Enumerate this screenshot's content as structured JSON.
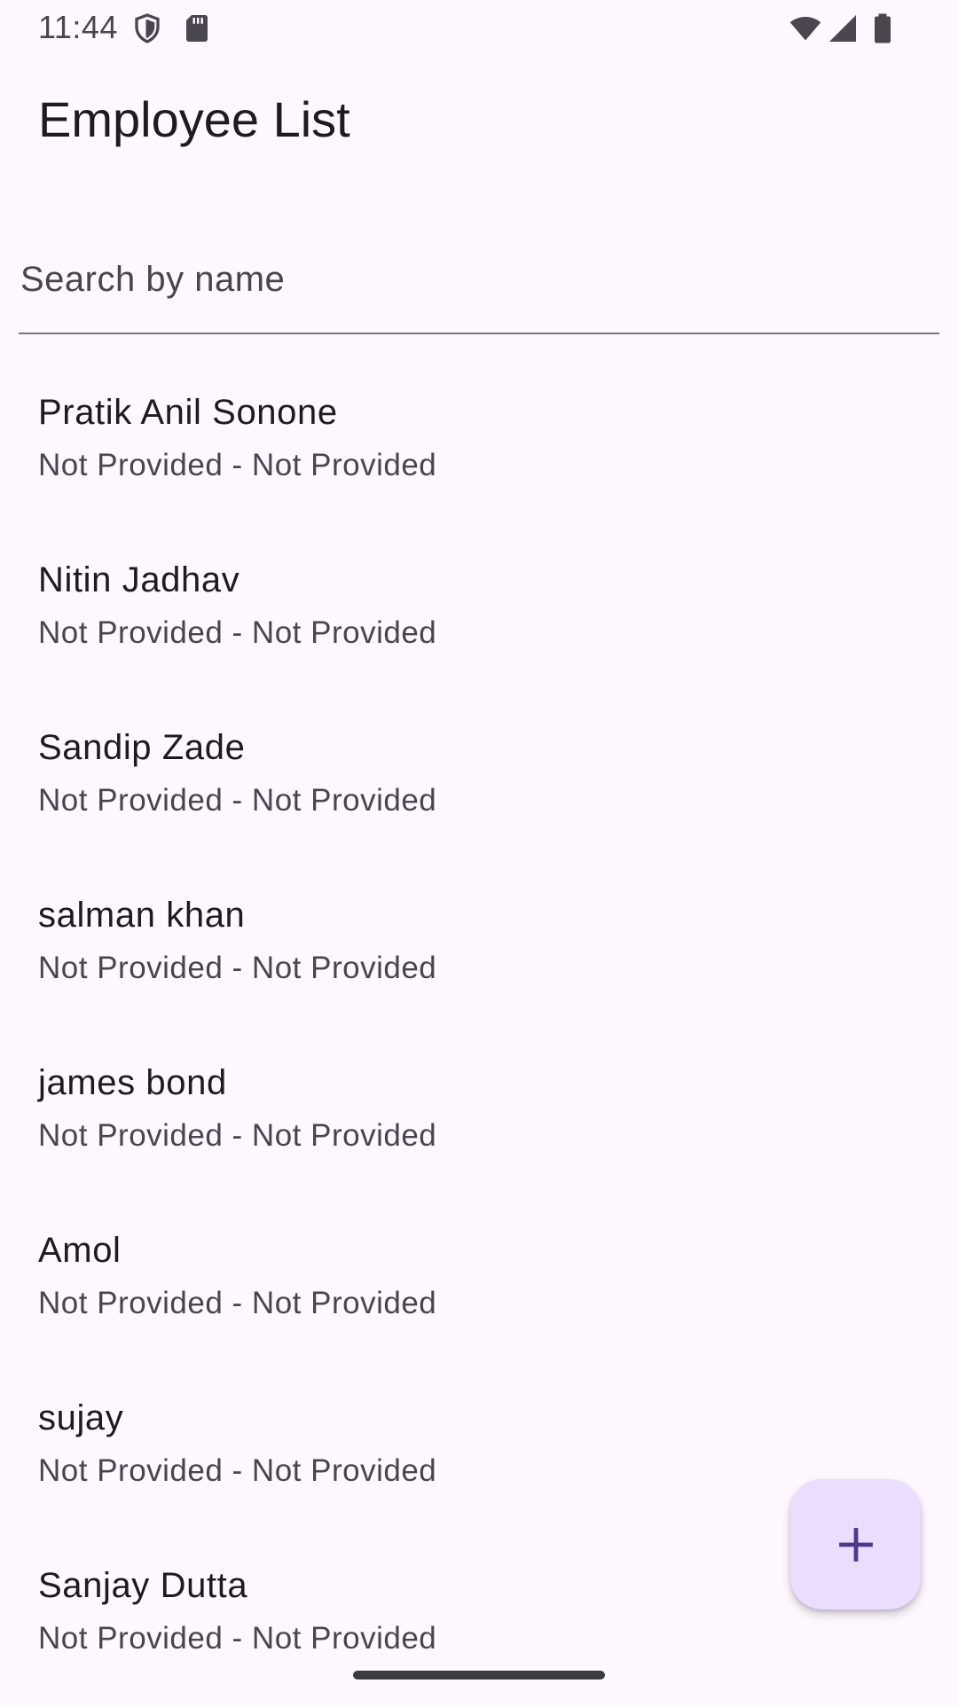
{
  "status_bar": {
    "time": "11:44",
    "icons": [
      "shield-icon",
      "sd-card-icon",
      "wifi-icon",
      "cell-signal-icon",
      "battery-icon"
    ]
  },
  "app_bar": {
    "title": "Employee List"
  },
  "search": {
    "placeholder": "Search by name",
    "value": ""
  },
  "employees": [
    {
      "name": "Pratik Anil Sonone",
      "subtitle": "Not Provided - Not Provided"
    },
    {
      "name": "Nitin Jadhav",
      "subtitle": "Not Provided - Not Provided"
    },
    {
      "name": "Sandip Zade",
      "subtitle": "Not Provided - Not Provided"
    },
    {
      "name": "salman khan",
      "subtitle": "Not Provided - Not Provided"
    },
    {
      "name": "james bond",
      "subtitle": "Not Provided - Not Provided"
    },
    {
      "name": "Amol",
      "subtitle": "Not Provided - Not Provided"
    },
    {
      "name": "sujay",
      "subtitle": "Not Provided - Not Provided"
    },
    {
      "name": "Sanjay Dutta",
      "subtitle": "Not Provided - Not Provided"
    }
  ],
  "fab": {
    "icon": "plus-icon"
  },
  "colors": {
    "background": "#fdf7fe",
    "fab_background": "#eaddff",
    "fab_icon": "#4f378b",
    "primary_text": "#1d1b20",
    "secondary_text": "#49454f"
  }
}
